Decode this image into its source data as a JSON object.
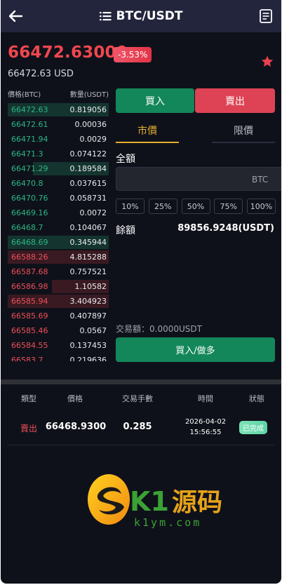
{
  "header": {
    "title": "BTC/USDT"
  },
  "ticker": {
    "price": "66472.63000",
    "change": "-3.53%",
    "usd": "66472.63 USD"
  },
  "orderbook": {
    "col_price": "價格(BTC)",
    "col_qty": "數量(USDT)",
    "buys": [
      {
        "price": "66472.63",
        "qty": "0.819056",
        "depth": 1.0
      },
      {
        "price": "66472.61",
        "qty": "0.00036",
        "depth": 0.0
      },
      {
        "price": "66471.94",
        "qty": "0.0029",
        "depth": 0.0
      },
      {
        "price": "66471.3",
        "qty": "0.074122",
        "depth": 0.0
      },
      {
        "price": "66471.29",
        "qty": "0.189584",
        "depth": 0.75
      },
      {
        "price": "66470.8",
        "qty": "0.037615",
        "depth": 0.0
      },
      {
        "price": "66470.76",
        "qty": "0.058731",
        "depth": 0.0
      },
      {
        "price": "66469.16",
        "qty": "0.0072",
        "depth": 0.0
      },
      {
        "price": "66468.7",
        "qty": "0.104067",
        "depth": 0.0
      },
      {
        "price": "66468.69",
        "qty": "0.345944",
        "depth": 1.0
      }
    ],
    "sells": [
      {
        "price": "66588.26",
        "qty": "4.815288",
        "depth": 1.0
      },
      {
        "price": "66587.68",
        "qty": "0.757521",
        "depth": 0.0
      },
      {
        "price": "66586.98",
        "qty": "1.10582",
        "depth": 0.56
      },
      {
        "price": "66585.94",
        "qty": "3.404923",
        "depth": 1.0
      },
      {
        "price": "66585.69",
        "qty": "0.407897",
        "depth": 0.0
      },
      {
        "price": "66585.46",
        "qty": "0.0567",
        "depth": 0.0
      },
      {
        "price": "66584.55",
        "qty": "0.137453",
        "depth": 0.0
      },
      {
        "price": "66583.7",
        "qty": "0.219636",
        "depth": 0.0
      }
    ]
  },
  "trade": {
    "buy_label": "買入",
    "sell_label": "賣出",
    "market_tab": "市價",
    "limit_tab": "限價",
    "amount_label": "全額",
    "amount_value": "",
    "amount_unit": "BTC",
    "percents": [
      "10%",
      "25%",
      "50%",
      "75%",
      "100%"
    ],
    "balance_label": "餘額",
    "balance_value": "89856.9248(USDT)",
    "tx_amount": "交易額：0.0000USDT",
    "submit_label": "買入/做多"
  },
  "history": {
    "headers": {
      "type": "類型",
      "price": "價格",
      "fee": "交易手數",
      "time": "時間",
      "status": "狀態"
    },
    "rows": [
      {
        "type": "賣出",
        "price": "66468.9300",
        "fee": "0.285",
        "date": "2026-04-02",
        "time": "15:56:55",
        "status": "已完成"
      }
    ]
  },
  "watermark": {
    "text": "K1源码",
    "domain": "k1ym.com"
  },
  "colors": {
    "up": "#29b885",
    "down": "#ef4f59",
    "accent": "#e5ad2d",
    "bg": "#0f111a"
  }
}
